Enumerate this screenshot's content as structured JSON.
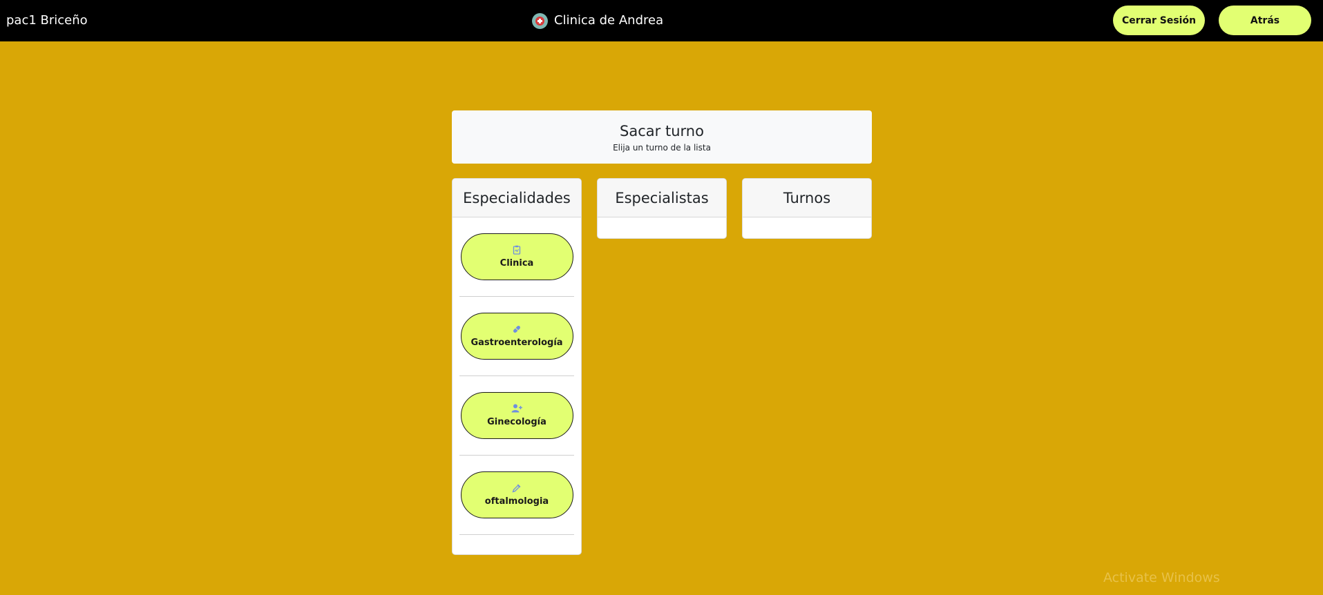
{
  "navbar": {
    "user_name": "pac1 Briceño",
    "brand": "Clinica de Andrea",
    "logout_label": "Cerrar Sesión",
    "back_label": "Atrás"
  },
  "header": {
    "title": "Sacar turno",
    "subtitle": "Elija un turno de la lista"
  },
  "columns": {
    "specialties": {
      "title": "Especialidades",
      "items": [
        {
          "label": "Clinica",
          "icon": "clipboard-icon"
        },
        {
          "label": "Gastroenterología",
          "icon": "pill-icon"
        },
        {
          "label": "Ginecología",
          "icon": "user-plus-icon"
        },
        {
          "label": "oftalmologia",
          "icon": "eyedropper-icon"
        }
      ]
    },
    "specialists": {
      "title": "Especialistas"
    },
    "turns": {
      "title": "Turnos"
    }
  },
  "colors": {
    "background": "#d9a706",
    "navbar": "#000000",
    "button": "#e2ff72",
    "icon": "#6f8fe0"
  },
  "watermark": "Activate Windows"
}
